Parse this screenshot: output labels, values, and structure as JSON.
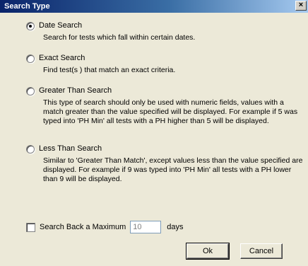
{
  "window": {
    "title": "Search Type",
    "close_label": "×"
  },
  "options": [
    {
      "label": "Date Search",
      "checked": true,
      "description": "Search for tests which fall within certain dates."
    },
    {
      "label": "Exact Search",
      "checked": false,
      "description": "Find test(s ) that match an exact criteria."
    },
    {
      "label": "Greater Than Search",
      "checked": false,
      "description": "This type of search should only be used with numeric fields, values with a match greater than the value specified will be displayed. For example if 5 was typed into 'PH Min' all tests with a PH higher than 5 will be displayed."
    },
    {
      "label": "Less Than Search",
      "checked": false,
      "description": "Similar to 'Greater Than Match', except values less than the value specified are displayed. For example if 9 was typed into 'PH Min' all tests with a PH lower than 9 will be displayed."
    }
  ],
  "max_search": {
    "label": "Search Back a Maximum",
    "checked": false,
    "value": "10",
    "unit": "days"
  },
  "buttons": {
    "ok": "Ok",
    "cancel": "Cancel"
  }
}
